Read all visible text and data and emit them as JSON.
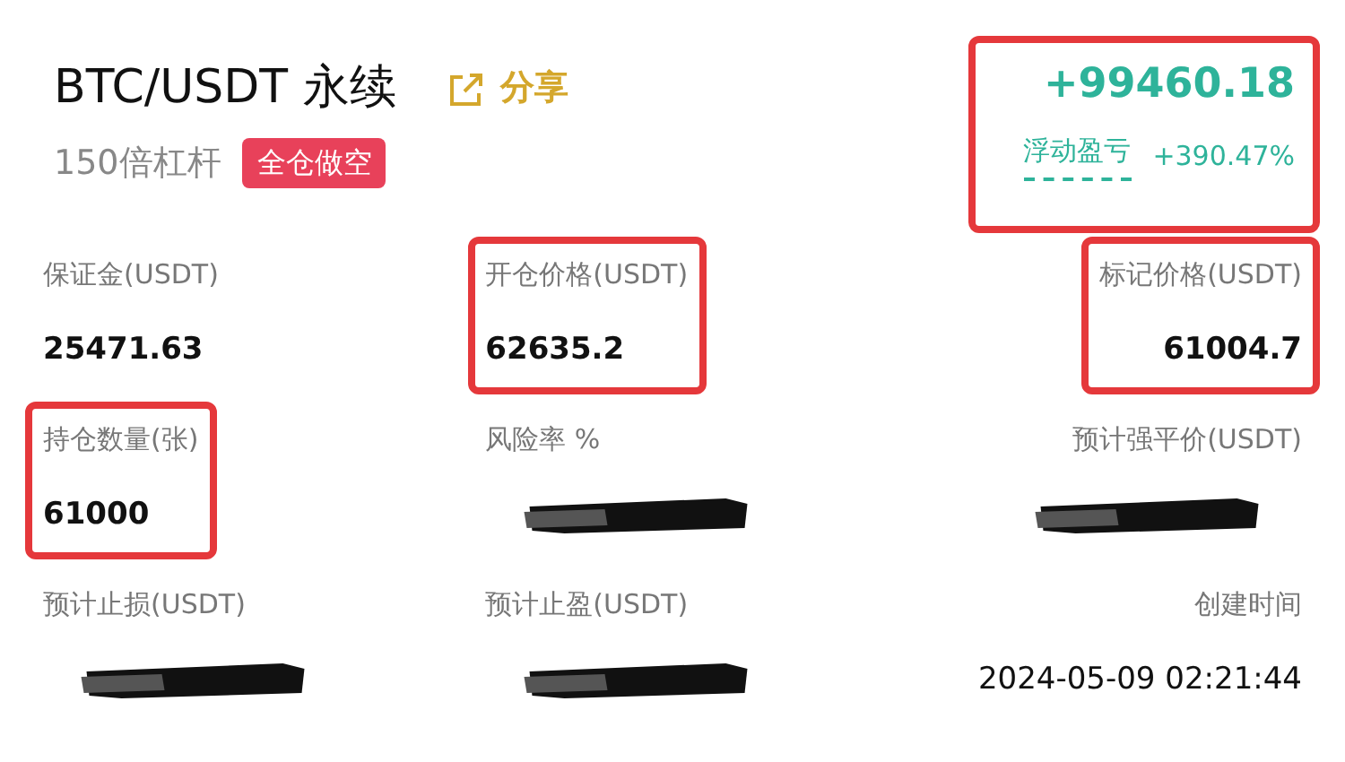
{
  "header": {
    "title": "BTC/USDT 永续",
    "share": "分享",
    "leverage": "150倍杠杆",
    "tag": "全仓做空"
  },
  "pnl": {
    "value": "+99460.18",
    "label": "浮动盈亏",
    "percent": "+390.47%",
    "highlighted": true
  },
  "fields": [
    {
      "label": "保证金(USDT)",
      "value": "25471.63",
      "highlighted": false,
      "redacted": false
    },
    {
      "label": "开仓价格(USDT)",
      "value": "62635.2",
      "highlighted": true,
      "redacted": false
    },
    {
      "label": "标记价格(USDT)",
      "value": "61004.7",
      "highlighted": true,
      "redacted": false
    },
    {
      "label": "持仓数量(张)",
      "value": "61000",
      "highlighted": true,
      "redacted": false
    },
    {
      "label": "风险率 %",
      "highlighted": false,
      "redacted": true
    },
    {
      "label": "预计强平价(USDT)",
      "highlighted": false,
      "redacted": true
    },
    {
      "label": "预计止损(USDT)",
      "highlighted": false,
      "redacted": true
    },
    {
      "label": "预计止盈(USDT)",
      "highlighted": false,
      "redacted": true
    },
    {
      "label": "创建时间",
      "value": "2024-05-09 02:21:44",
      "highlighted": false,
      "redacted": false
    }
  ]
}
